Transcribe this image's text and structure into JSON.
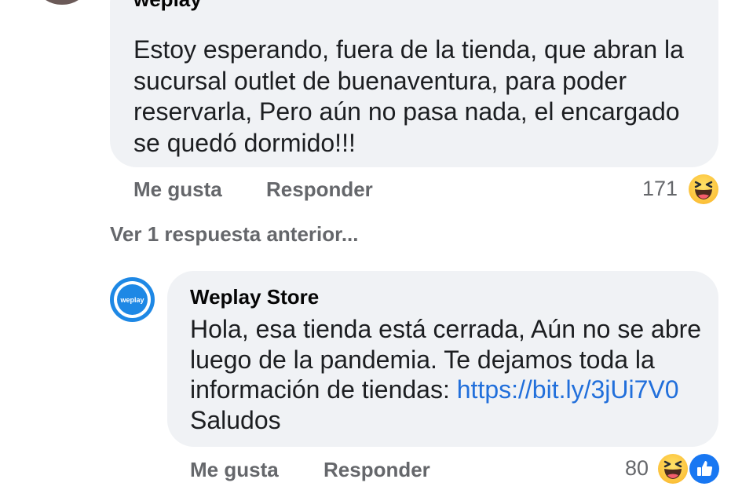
{
  "comment": {
    "author_partial": "weplay",
    "text": "Estoy esperando, fuera de la tienda, que abran la sucursal outlet de buenaventura, para poder reservarla, Pero aún no pasa nada, el encargado se quedó dormido!!!",
    "actions": {
      "like": "Me gusta",
      "reply": "Responder"
    },
    "reaction_count": "171",
    "reaction_icons": [
      "haha-icon"
    ]
  },
  "previous_replies_link": "Ver 1 respuesta anterior...",
  "reply": {
    "author": "Weplay Store",
    "avatar_text": "weplay",
    "text_before_link": "Hola, esa tienda está cerrada, Aún no se abre luego de la pandemia. Te dejamos toda la información de tiendas: ",
    "link": "https://bit.ly/3jUi7V0",
    "text_after_link": " Saludos",
    "actions": {
      "like": "Me gusta",
      "reply": "Responder"
    },
    "reaction_count": "80",
    "reaction_icons": [
      "haha-icon",
      "like-icon"
    ]
  },
  "colors": {
    "bubble": "#f0f2f5",
    "secondary_text": "#65676b",
    "link": "#216fdb",
    "brand_blue": "#1877f2"
  }
}
